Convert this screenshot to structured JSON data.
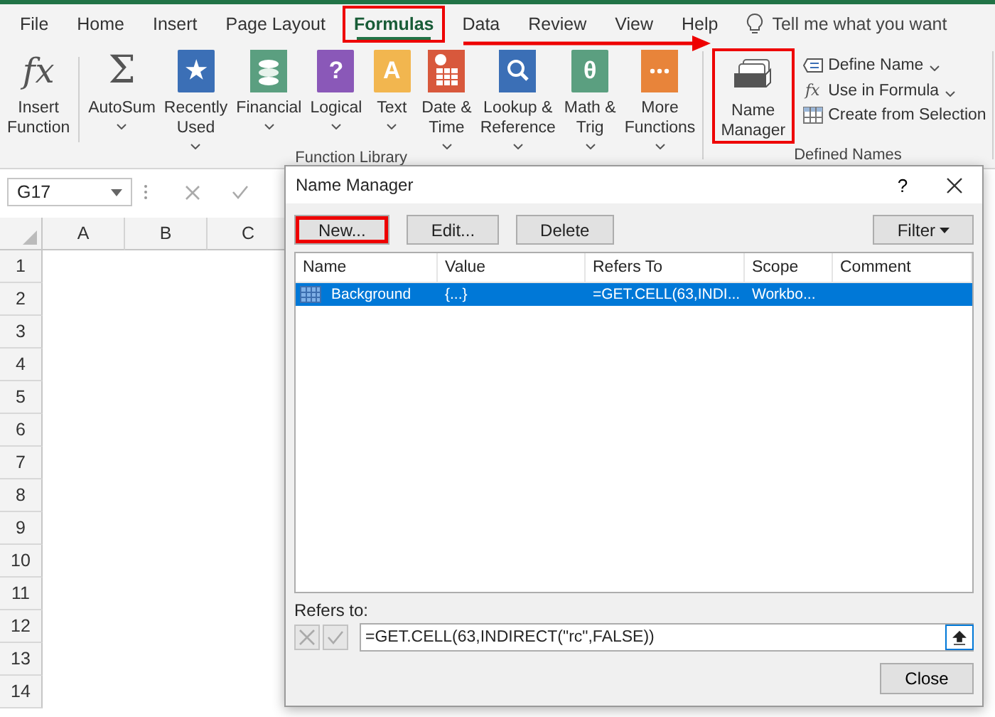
{
  "ribbon_tabs": [
    {
      "label": "File",
      "selected": false,
      "highlighted": false
    },
    {
      "label": "Home",
      "selected": false,
      "highlighted": false
    },
    {
      "label": "Insert",
      "selected": false,
      "highlighted": false
    },
    {
      "label": "Page Layout",
      "selected": false,
      "highlighted": false
    },
    {
      "label": "Formulas",
      "selected": true,
      "highlighted": true
    },
    {
      "label": "Data",
      "selected": false,
      "highlighted": false
    },
    {
      "label": "Review",
      "selected": false,
      "highlighted": false
    },
    {
      "label": "View",
      "selected": false,
      "highlighted": false
    },
    {
      "label": "Help",
      "selected": false,
      "highlighted": false
    }
  ],
  "tell_me": "Tell me what you want",
  "annotation_arrow": true,
  "function_library": {
    "label": "Function Library",
    "buttons": [
      {
        "kind": "plain",
        "glyph": "fx",
        "lines": [
          "Insert",
          "Function"
        ],
        "dropdown": false
      },
      {
        "kind": "plain",
        "glyph": "Σ",
        "lines": [
          "AutoSum"
        ],
        "dropdown": true
      },
      {
        "kind": "book",
        "glyph": "★",
        "color": "#3b6fb6",
        "lines": [
          "Recently",
          "Used"
        ],
        "dropdown": true
      },
      {
        "kind": "coins",
        "color": "#5b9f80",
        "lines": [
          "Financial"
        ],
        "dropdown": true
      },
      {
        "kind": "book",
        "glyph": "?",
        "color": "#8a58b8",
        "lines": [
          "Logical"
        ],
        "dropdown": true
      },
      {
        "kind": "book",
        "glyph": "A",
        "color": "#f2b64f",
        "lines": [
          "Text"
        ],
        "dropdown": true
      },
      {
        "kind": "calendar",
        "color": "#d8583c",
        "lines": [
          "Date &",
          "Time"
        ],
        "dropdown": true
      },
      {
        "kind": "search",
        "color": "#3b6fb6",
        "lines": [
          "Lookup &",
          "Reference"
        ],
        "dropdown": true
      },
      {
        "kind": "book",
        "glyph": "θ",
        "color": "#5b9f80",
        "lines": [
          "Math &",
          "Trig"
        ],
        "dropdown": true
      },
      {
        "kind": "dots",
        "color": "#e8843a",
        "lines": [
          "More",
          "Functions"
        ],
        "dropdown": true
      }
    ]
  },
  "defined_names": {
    "label": "Defined Names",
    "manager": {
      "lines": [
        "Name",
        "Manager"
      ],
      "highlighted": true
    },
    "items": [
      {
        "kind": "tag",
        "label": "Define Name",
        "dropdown": true
      },
      {
        "kind": "glyph",
        "glyph": "fx",
        "label": "Use in Formula",
        "dropdown": true
      },
      {
        "kind": "grid",
        "label": "Create from Selection",
        "dropdown": false
      }
    ]
  },
  "formula_bar": {
    "name_box": "G17"
  },
  "sheet": {
    "columns": [
      "A",
      "B",
      "C"
    ],
    "rows": [
      "1",
      "2",
      "3",
      "4",
      "5",
      "6",
      "7",
      "8",
      "9",
      "10",
      "11",
      "12",
      "13",
      "14"
    ]
  },
  "dialog": {
    "title": "Name Manager",
    "help": "?",
    "buttons": [
      {
        "label": "New...",
        "highlighted": true
      },
      {
        "label": "Edit...",
        "highlighted": false
      },
      {
        "label": "Delete",
        "highlighted": false
      }
    ],
    "filter": {
      "label": "Filter",
      "dropdown": true
    },
    "columns": [
      "Name",
      "Value",
      "Refers To",
      "Scope",
      "Comment"
    ],
    "rows": [
      {
        "name": "Background",
        "value": "{...}",
        "refers_to": "=GET.CELL(63,INDI...",
        "scope": "Workbo...",
        "selected": true
      }
    ],
    "refers_label": "Refers to:",
    "refers_value": "=GET.CELL(63,INDIRECT(\"rc\",FALSE))",
    "close": "Close"
  }
}
